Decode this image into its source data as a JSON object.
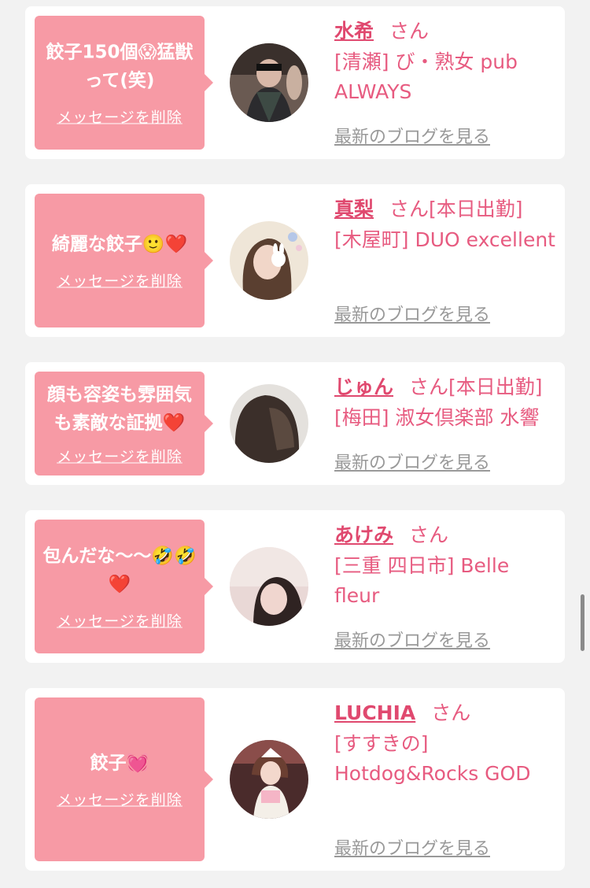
{
  "delete_label": "メッセージを削除",
  "blog_label": "最新のブログを見る",
  "san_label": "さん",
  "colors": {
    "bubble": "#f79aa5",
    "accent": "#e75b80",
    "background": "#f2f2f2"
  },
  "entries": [
    {
      "message": "餃子150個😱猛獣って(笑)",
      "name": "水希",
      "status": "",
      "shop": "[清瀬] び・熟女 pub ALWAYS"
    },
    {
      "message": "綺麗な餃子🙂❤️",
      "name": "真梨",
      "status": "[本日出勤]",
      "shop": "[木屋町] DUO excellent"
    },
    {
      "message": "顔も容姿も雰囲気も素敵な証拠❤️",
      "name": "じゅん",
      "status": "[本日出勤]",
      "shop": "[梅田] 淑女倶楽部 水響"
    },
    {
      "message": "包んだな〜〜🤣🤣❤️",
      "name": "あけみ",
      "status": "",
      "shop": "[三重 四日市] Belle fleur"
    },
    {
      "message": "餃子💓",
      "name": "LUCHIA",
      "status": "",
      "shop": "[すすきの] Hotdog&Rocks GOD"
    }
  ]
}
